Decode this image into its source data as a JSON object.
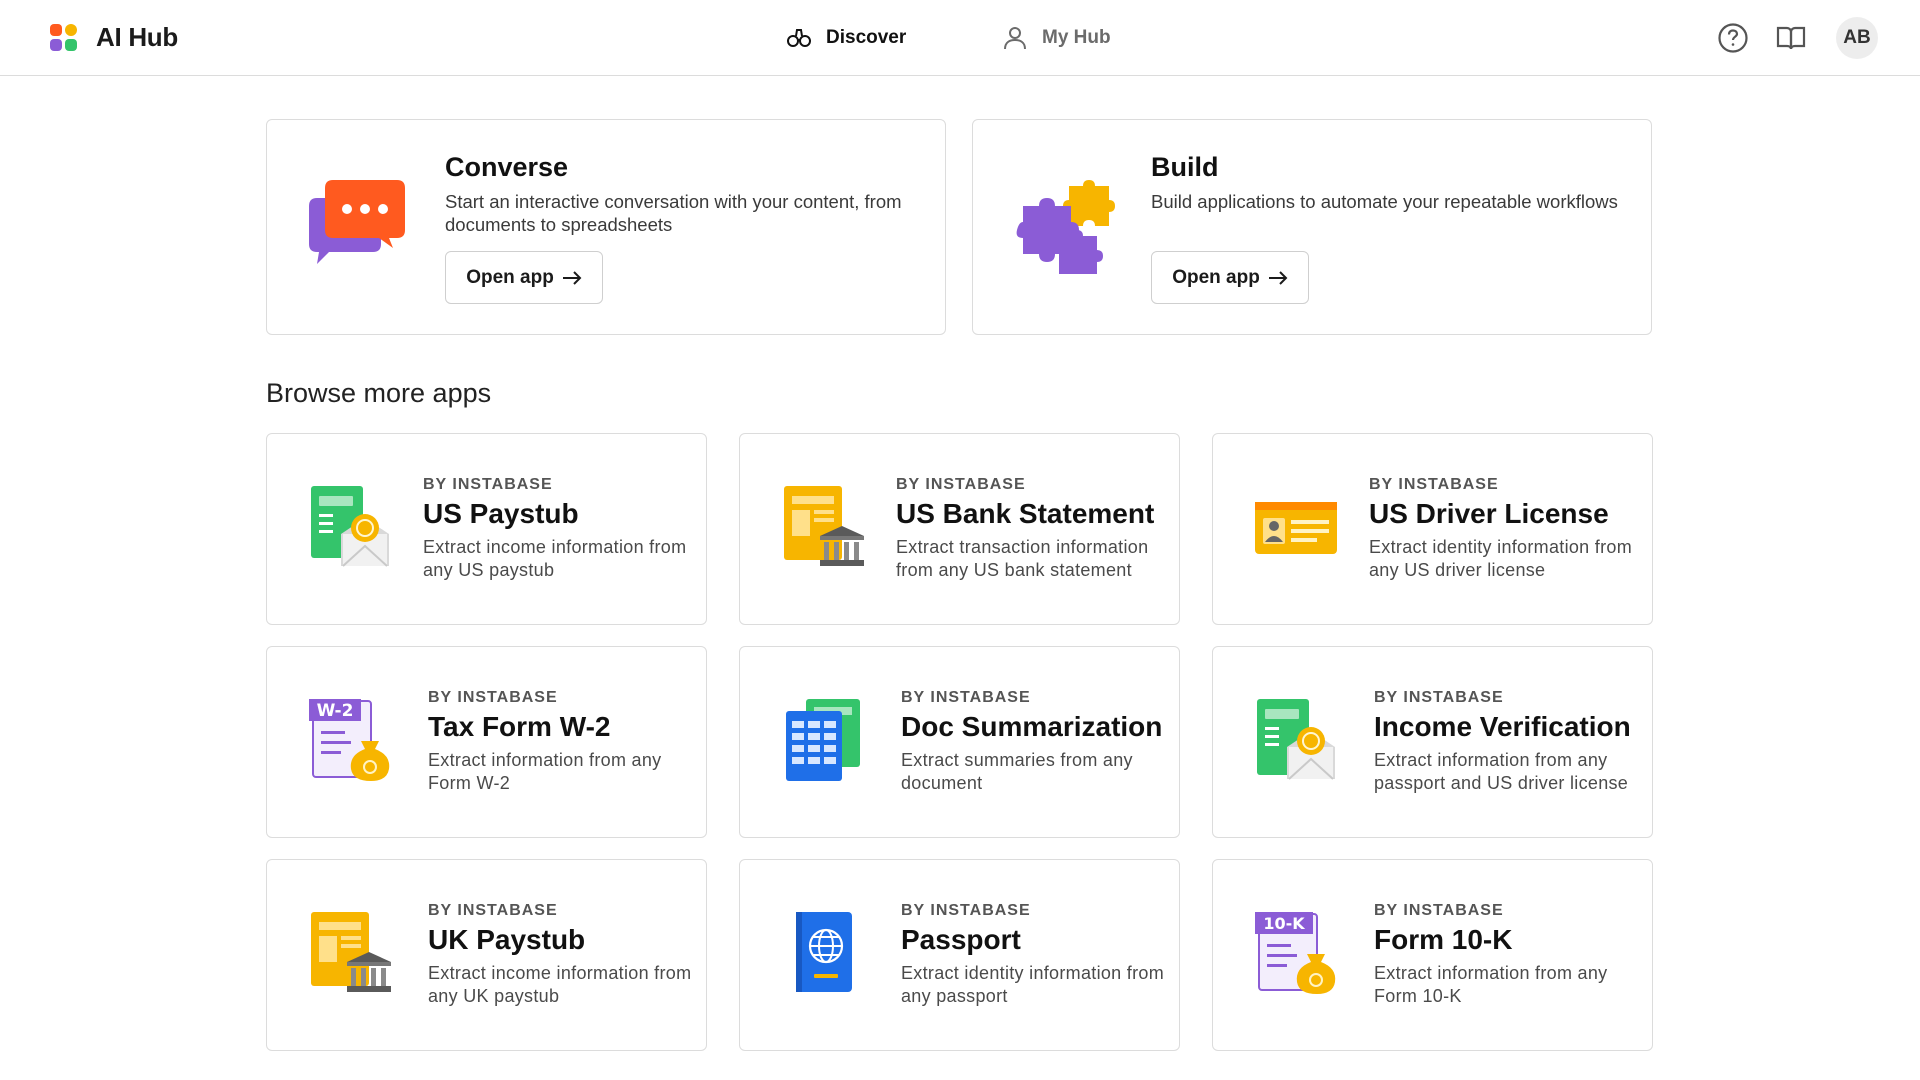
{
  "header": {
    "brand_title": "AI Hub",
    "nav": [
      {
        "label": "Discover",
        "icon": "binoculars-icon",
        "active": true
      },
      {
        "label": "My Hub",
        "icon": "user-icon",
        "active": false
      }
    ],
    "help_icon": "help-circle-icon",
    "docs_icon": "book-icon",
    "avatar_initials": "AB"
  },
  "featured": [
    {
      "title": "Converse",
      "description": "Start an interactive conversation with your content, from documents to spreadsheets",
      "button_label": "Open app",
      "icon": "chat-bubbles-icon"
    },
    {
      "title": "Build",
      "description": "Build applications to automate your repeatable workflows",
      "button_label": "Open app",
      "icon": "puzzle-icon"
    }
  ],
  "browse": {
    "title": "Browse more apps",
    "apps": [
      {
        "by": "BY INSTABASE",
        "title": "US Paystub",
        "description": "Extract income information from any US paystub",
        "icon": "paystub-envelope-icon"
      },
      {
        "by": "BY INSTABASE",
        "title": "US Bank Statement",
        "description": "Extract transaction information from any US bank statement",
        "icon": "bank-statement-icon"
      },
      {
        "by": "BY INSTABASE",
        "title": "US Driver License",
        "description": "Extract identity information from any US driver license",
        "icon": "id-card-icon"
      },
      {
        "by": "BY INSTABASE",
        "title": "Tax Form W-2",
        "description": "Extract information from any Form W-2",
        "icon": "w2-form-icon",
        "badge": "W-2"
      },
      {
        "by": "BY INSTABASE",
        "title": "Doc Summarization",
        "description": "Extract summaries from any document",
        "icon": "spreadsheet-icon"
      },
      {
        "by": "BY INSTABASE",
        "title": "Income Verification",
        "description": "Extract information from any passport and US driver license",
        "icon": "income-envelope-icon"
      },
      {
        "by": "BY INSTABASE",
        "title": "UK Paystub",
        "description": "Extract income information from any UK paystub",
        "icon": "uk-paystub-bank-icon"
      },
      {
        "by": "BY INSTABASE",
        "title": "Passport",
        "description": "Extract identity information from any passport",
        "icon": "passport-icon"
      },
      {
        "by": "BY INSTABASE",
        "title": "Form 10-K",
        "description": "Extract information from any Form 10-K",
        "icon": "10k-form-icon",
        "badge": "10-K"
      }
    ]
  },
  "colors": {
    "border": "#dcdcdc",
    "green": "#34c46b",
    "yellow": "#f7b500",
    "purple": "#8b5cd6",
    "blue": "#1f6fe8",
    "orange": "#ff5a1f"
  }
}
